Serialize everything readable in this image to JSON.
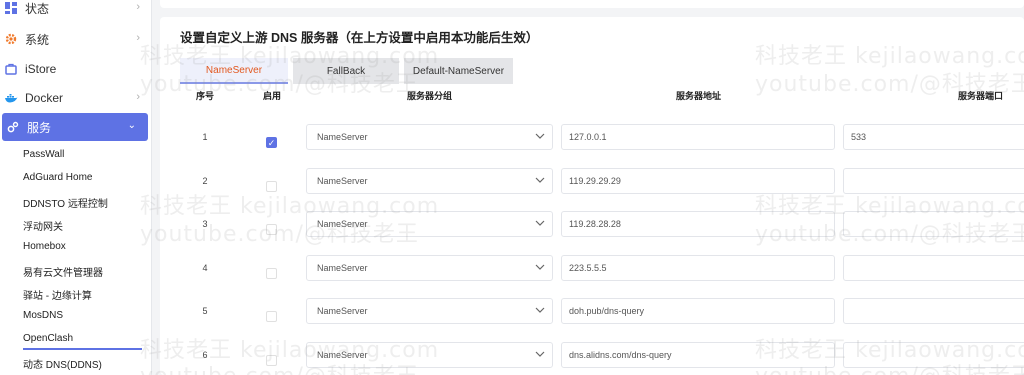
{
  "sidebar": {
    "items": [
      {
        "label": "状态",
        "icon": "dashboard-icon"
      },
      {
        "label": "系统",
        "icon": "gear-icon"
      },
      {
        "label": "iStore",
        "icon": "store-icon"
      },
      {
        "label": "Docker",
        "icon": "docker-icon"
      },
      {
        "label": "服务",
        "icon": "services-icon"
      }
    ],
    "sub_items": [
      "PassWall",
      "AdGuard Home",
      "DDNSTO 远程控制",
      "浮动网关",
      "Homebox",
      "易有云文件管理器",
      "驿站 - 边缘计算",
      "MosDNS",
      "OpenClash",
      "动态 DNS(DDNS)"
    ]
  },
  "main": {
    "title": "设置自定义上游 DNS 服务器（在上方设置中启用本功能后生效）",
    "tabs": [
      "NameServer",
      "FallBack",
      "Default-NameServer"
    ],
    "columns": [
      "序号",
      "启用",
      "服务器分组",
      "服务器地址",
      "服务器端口"
    ],
    "rows": [
      {
        "idx": "1",
        "enabled": true,
        "group": "NameServer",
        "address": "127.0.0.1",
        "port": "533"
      },
      {
        "idx": "2",
        "enabled": false,
        "group": "NameServer",
        "address": "119.29.29.29",
        "port": ""
      },
      {
        "idx": "3",
        "enabled": false,
        "group": "NameServer",
        "address": "119.28.28.28",
        "port": ""
      },
      {
        "idx": "4",
        "enabled": false,
        "group": "NameServer",
        "address": "223.5.5.5",
        "port": ""
      },
      {
        "idx": "5",
        "enabled": false,
        "group": "NameServer",
        "address": "doh.pub/dns-query",
        "port": ""
      },
      {
        "idx": "6",
        "enabled": false,
        "group": "NameServer",
        "address": "dns.alidns.com/dns-query",
        "port": ""
      }
    ]
  },
  "watermark": {
    "line1": "科技老王 kejilaowang.com",
    "line2": "youtube.com/@科技老王"
  },
  "colors": {
    "accent": "#5e72e4",
    "active_tab_text": "#e2571e"
  }
}
